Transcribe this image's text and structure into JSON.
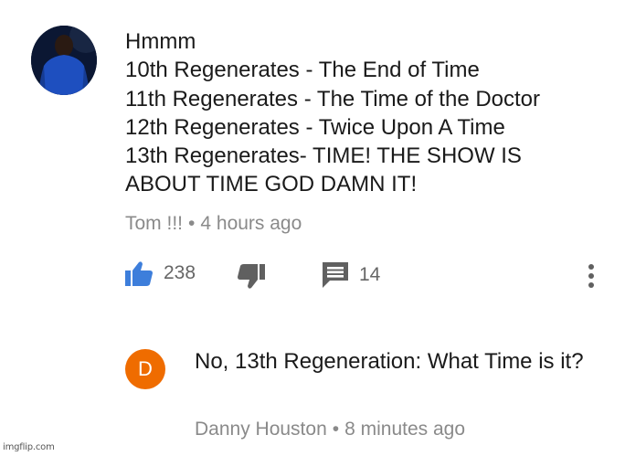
{
  "comment": {
    "avatar_icon": "user-avatar-icon",
    "lines": [
      "Hmmm",
      "10th Regenerates - The End of Time",
      "11th Regenerates - The Time of the Doctor",
      "12th Regenerates - Twice Upon A Time",
      "13th Regenerates- TIME! THE SHOW IS",
      "ABOUT TIME GOD DAMN IT!"
    ],
    "author": "Tom !!!",
    "separator": "•",
    "time": "4 hours ago",
    "like_count": "238",
    "reply_count": "14",
    "like_icon": "thumbs-up-icon",
    "dislike_icon": "thumbs-down-icon",
    "reply_icon": "reply-icon",
    "more_icon": "more-vertical-icon",
    "accent_color": "#3d7edb"
  },
  "reply": {
    "avatar_letter": "D",
    "avatar_color": "#ef6c00",
    "text": "No, 13th Regeneration: What Time is it?",
    "author": "Danny Houston",
    "separator": "•",
    "time": "8 minutes ago"
  },
  "watermark": "imgflip.com"
}
